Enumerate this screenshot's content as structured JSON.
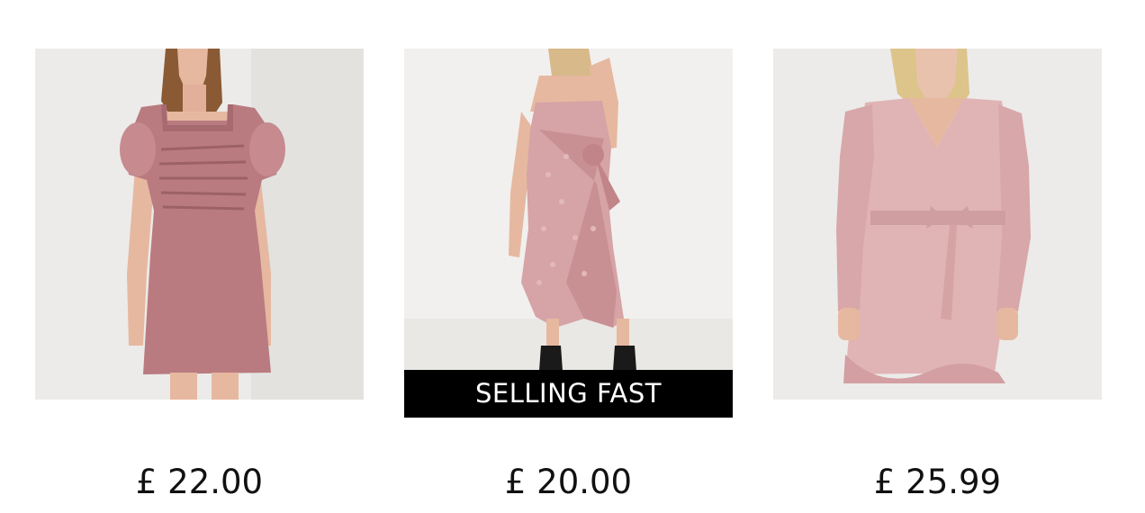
{
  "products": [
    {
      "image": "pink square neck puff sleeve bodycon dress on model",
      "price": "£ 22.00",
      "badge": ""
    },
    {
      "image": "pink satin leopard wrap midi dress on model",
      "price": "£ 20.00",
      "badge": "SELLING FAST"
    },
    {
      "image": "pale pink long sleeve wrap frill dress on model",
      "price": "£ 25.99",
      "badge": ""
    }
  ],
  "colors": {
    "dress_1": "#b97b80",
    "dress_2": "#d6a3a6",
    "dress_3": "#e0b4b5",
    "skin": "#e6b8a0",
    "hair_1": "#8a5a34",
    "hair_3": "#dcc48a",
    "badge_bg": "#000000",
    "badge_text": "#ffffff",
    "price_text": "#111111"
  }
}
